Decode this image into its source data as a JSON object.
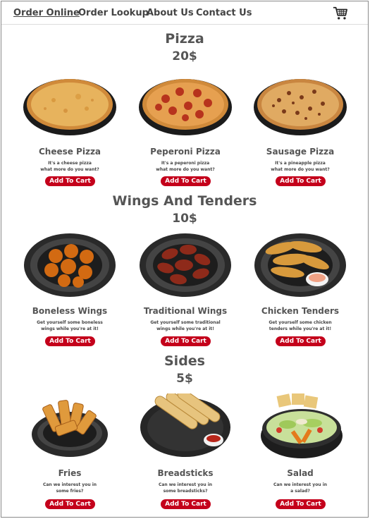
{
  "nav": {
    "links": [
      "Order Online",
      "Order Lookup",
      "About Us",
      "Contact Us"
    ],
    "cart_icon": "shopping-cart-icon"
  },
  "colors": {
    "button": "#c4001b",
    "text": "#555555"
  },
  "sections": [
    {
      "title": "Pizza",
      "price": "20$",
      "items": [
        {
          "name": "Cheese Pizza",
          "desc1": "It's a cheese pizza",
          "desc2": "what more do you want?",
          "button": "Add To Cart"
        },
        {
          "name": "Peperoni Pizza",
          "desc1": "It's a peperoni pizza",
          "desc2": "what more do you want?",
          "button": "Add To Cart"
        },
        {
          "name": "Sausage Pizza",
          "desc1": "It's a pineapple pizza",
          "desc2": "what more do you want?",
          "button": "Add To Cart"
        }
      ]
    },
    {
      "title": "Wings And Tenders",
      "price": "10$",
      "items": [
        {
          "name": "Boneless Wings",
          "desc1": "Get yourself some boneless",
          "desc2": "wings while you're at it!",
          "button": "Add To Cart"
        },
        {
          "name": "Traditional Wings",
          "desc1": "Get yourself some traditional",
          "desc2": "wings while you're at it!",
          "button": "Add To Cart"
        },
        {
          "name": "Chicken Tenders",
          "desc1": "Get yourself some chicken",
          "desc2": "tenders while you're at it!",
          "button": "Add To Cart"
        }
      ]
    },
    {
      "title": "Sides",
      "price": "5$",
      "items": [
        {
          "name": "Fries",
          "desc1": "Can we interest you in",
          "desc2": "some fries?",
          "button": "Add To Cart"
        },
        {
          "name": "Breadsticks",
          "desc1": "Can we interest you in",
          "desc2": "some breadsticks?",
          "button": "Add To Cart"
        },
        {
          "name": "Salad",
          "desc1": "Can we interest you in",
          "desc2": "a salad?",
          "button": "Add To Cart"
        }
      ]
    }
  ]
}
